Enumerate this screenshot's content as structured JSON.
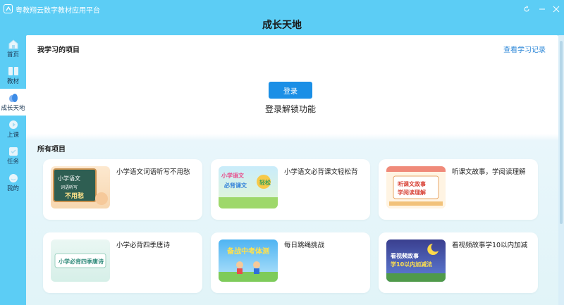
{
  "app": {
    "title": "粤教翔云数字教材应用平台"
  },
  "header": {
    "title": "成长天地"
  },
  "sidebar": {
    "items": [
      {
        "label": "首页",
        "icon": "home-icon"
      },
      {
        "label": "教材",
        "icon": "book-icon"
      },
      {
        "label": "成长天地",
        "icon": "growth-icon",
        "active": true
      },
      {
        "label": "上课",
        "icon": "class-icon"
      },
      {
        "label": "任务",
        "icon": "task-icon"
      },
      {
        "label": "我的",
        "icon": "profile-icon"
      }
    ]
  },
  "my_projects": {
    "title": "我学习的项目",
    "history_link": "查看学习记录",
    "login_button": "登录",
    "login_hint": "登录解锁功能"
  },
  "all_projects": {
    "title": "所有项目",
    "cards": [
      {
        "title": "小学语文词语听写不用愁",
        "thumb_text": "小学语文 词语听写 不用愁"
      },
      {
        "title": "小学语文必背课文轻松背",
        "thumb_text": "小学语文 必背课文 轻松背"
      },
      {
        "title": "听课文故事，学阅读理解",
        "thumb_text": "听课文故事 学阅读理解"
      },
      {
        "title": "小学必背四季唐诗",
        "thumb_text": "小学必背四季唐诗"
      },
      {
        "title": "每日跳绳挑战",
        "thumb_text": "备战中考体测"
      },
      {
        "title": "看视频故事学10以内加减",
        "thumb_text": "看视频故事 学10以内加减法"
      }
    ]
  },
  "colors": {
    "accent": "#1b8fe6",
    "background": "#5ccdf5",
    "link": "#2f88d8"
  }
}
